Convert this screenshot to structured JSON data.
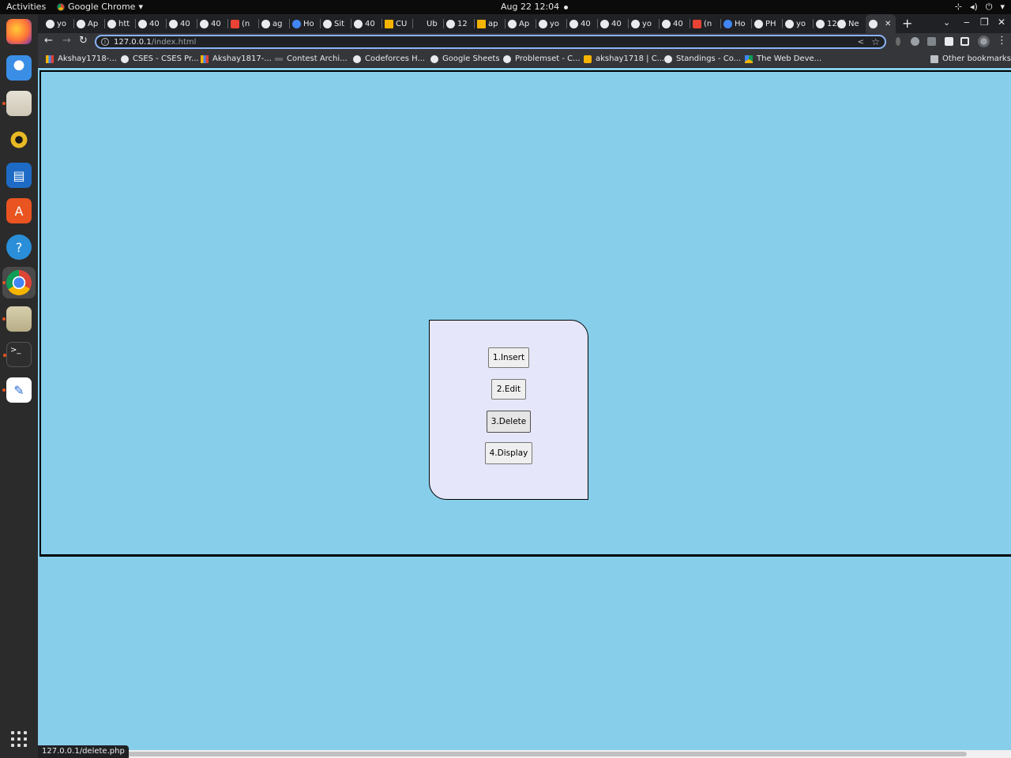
{
  "topbar": {
    "activities": "Activities",
    "app_name": "Google Chrome",
    "app_caret": "▾",
    "clock": "Aug 22  12:04",
    "sys_icons": [
      "network-icon",
      "volume-icon",
      "power-icon"
    ]
  },
  "dock": {
    "items": [
      "firefox",
      "thunderbird",
      "files",
      "rhythmbox",
      "writer",
      "app-center",
      "help",
      "chrome",
      "archive",
      "terminal",
      "text-editor"
    ]
  },
  "tabs": [
    {
      "label": "yo"
    },
    {
      "label": "Ap"
    },
    {
      "label": "htt"
    },
    {
      "label": "40"
    },
    {
      "label": "40"
    },
    {
      "label": "40"
    },
    {
      "label": "(n"
    },
    {
      "label": "ag"
    },
    {
      "label": "Ho"
    },
    {
      "label": "Sit"
    },
    {
      "label": "40"
    },
    {
      "label": "CU"
    },
    {
      "label": "Ub"
    },
    {
      "label": "12"
    },
    {
      "label": "ap"
    },
    {
      "label": "Ap"
    },
    {
      "label": "yo"
    },
    {
      "label": "40"
    },
    {
      "label": "40"
    },
    {
      "label": "yo"
    },
    {
      "label": "40"
    },
    {
      "label": "(n"
    },
    {
      "label": "Ho"
    },
    {
      "label": "PH"
    },
    {
      "label": "yo"
    },
    {
      "label": "12"
    },
    {
      "label": "Ne"
    }
  ],
  "active_tab": {
    "close": "✕"
  },
  "toolbar": {
    "back": "←",
    "forward": "→",
    "reload": "↻",
    "url_host": "127.0.0.1",
    "url_path": "/index.html",
    "new_tab": "+",
    "tab_search": "⌄",
    "minimize": "‒",
    "restore": "❐",
    "close": "✕",
    "menu": "⋮"
  },
  "bookmarks": [
    {
      "label": "Akshay1718-..."
    },
    {
      "label": "CSES - CSES Pr..."
    },
    {
      "label": "Akshay1817-..."
    },
    {
      "label": "Contest Archi..."
    },
    {
      "label": "Codeforces H..."
    },
    {
      "label": "Google Sheets"
    },
    {
      "label": "Problemset - C..."
    },
    {
      "label": "akshay1718 | C..."
    },
    {
      "label": "Standings - Co..."
    },
    {
      "label": "The Web Deve..."
    }
  ],
  "other_bookmarks": "Other bookmarks",
  "menu": {
    "buttons": [
      {
        "label": "1.Insert"
      },
      {
        "label": "2.Edit"
      },
      {
        "label": "3.Delete"
      },
      {
        "label": "4.Display"
      }
    ]
  },
  "status_url": "127.0.0.1/delete.php",
  "colors": {
    "page_background": "#87ceeb",
    "card_background": "#e6e6fa"
  }
}
